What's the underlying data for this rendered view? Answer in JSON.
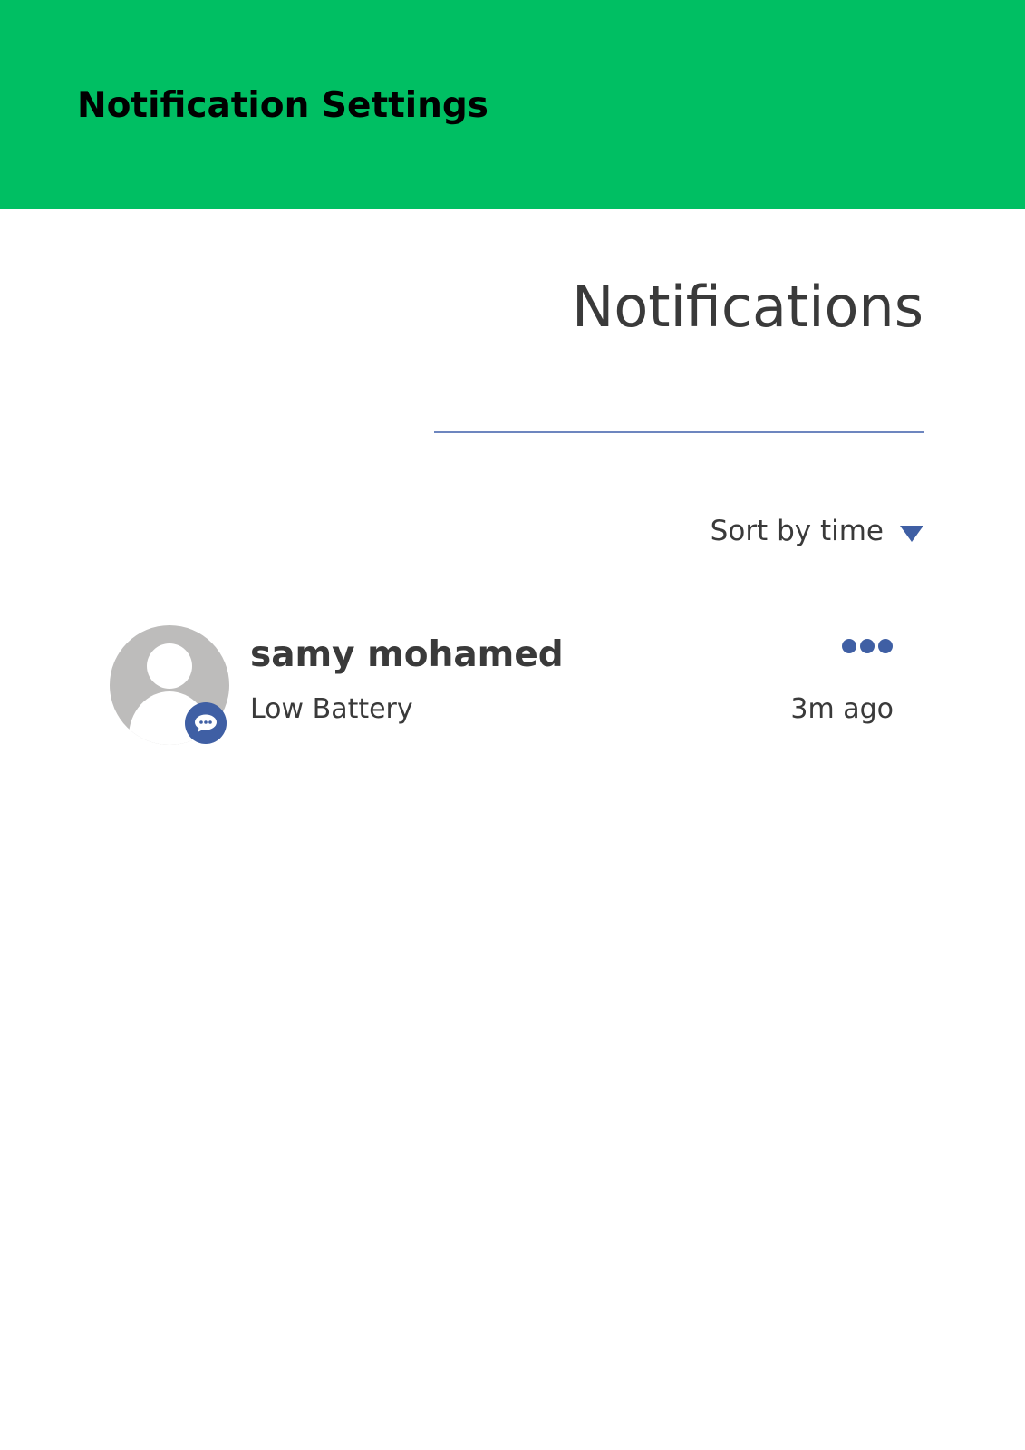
{
  "header": {
    "title": "Notification Settings",
    "background_color": "#00bf63"
  },
  "main": {
    "title": "Notifications",
    "accent_color": "#3f5fa4",
    "sort": {
      "label": "Sort by time",
      "icon": "caret-down-icon"
    },
    "notifications": [
      {
        "sender": "samy mohamed",
        "message": "Low Battery",
        "time": "3m ago",
        "avatar_icon": "user-avatar-icon",
        "badge_icon": "chat-bubble-icon",
        "menu_icon": "more-options-icon"
      }
    ]
  }
}
